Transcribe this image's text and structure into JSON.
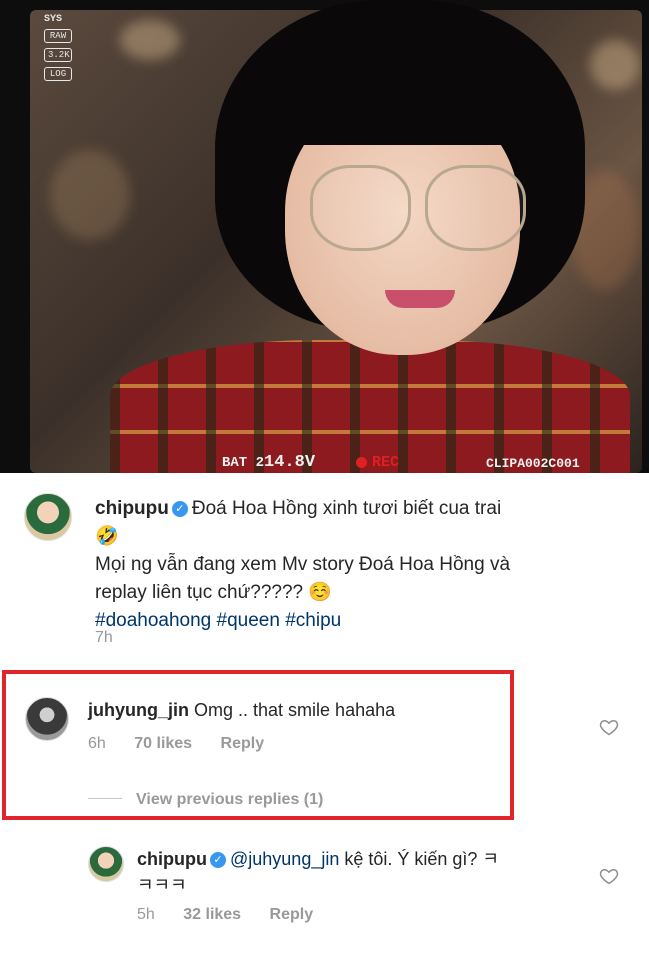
{
  "photo": {
    "sys_label": "SYS",
    "sys_boxes": [
      "RAW",
      "3.2K",
      "LOG"
    ],
    "battery_prefix": "BAT",
    "battery_number": "2",
    "battery_voltage": "14.8V",
    "rec_label": "REC",
    "clip_label": "CLIPA002C001"
  },
  "post": {
    "username": "chipupu",
    "caption_line1": "Đoá Hoa Hồng xinh tươi biết cua trai",
    "caption_emoji1": "🤣",
    "caption_line2": "Mọi ng vẫn đang xem Mv story  Đoá Hoa Hồng và",
    "caption_line3": "replay liên tục chứ????? ☺️",
    "hashtags": [
      "#doahoahong",
      "#queen",
      "#chipu"
    ],
    "time": "7h"
  },
  "comment": {
    "username": "juhyung_jin",
    "text": "Omg .. that smile  hahaha",
    "time": "6h",
    "likes": "70 likes",
    "reply": "Reply",
    "view_previous": "View previous replies (1)"
  },
  "reply": {
    "username": "chipupu",
    "mention": "@juhyung_jin",
    "text": " kệ tôi. Ý kiến gì? ㅋ",
    "text_line2": "ㅋㅋㅋ",
    "time": "5h",
    "likes": "32 likes",
    "reply": "Reply"
  },
  "colors": {
    "highlight_border": "#e0252b",
    "verified_badge": "#3897f0",
    "hashtag": "#003569",
    "meta_gray": "#999999"
  }
}
